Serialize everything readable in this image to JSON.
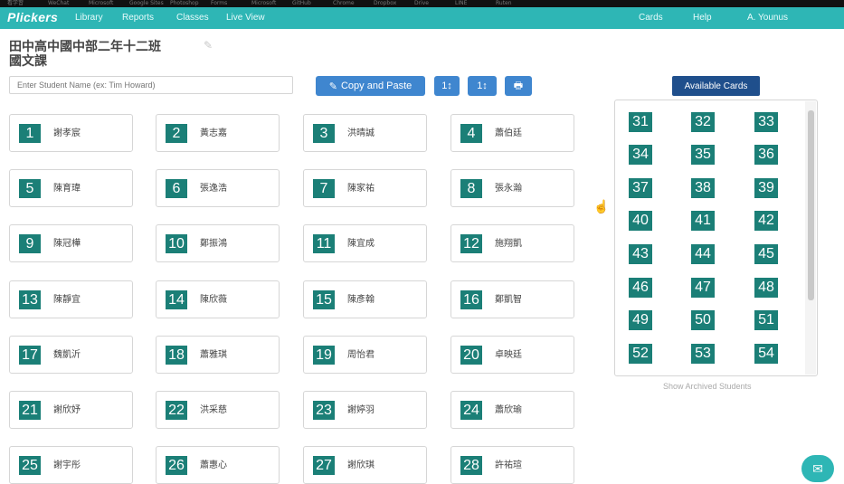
{
  "bookmarks": [
    "看学習",
    "WeChat",
    "Microsoft",
    "Google Sites",
    "Photoshop",
    "Forms",
    "Microsoft",
    "GitHub",
    "Chrome",
    "Dropbox",
    "Drive",
    "LINE",
    "Ruten"
  ],
  "nav": {
    "logo": "Plickers",
    "links": [
      "Library",
      "Reports",
      "Classes",
      "Live View"
    ],
    "right": [
      "Cards",
      "Help",
      "A. Younus"
    ]
  },
  "class": {
    "title_line1": "田中高中國中部二年十二班",
    "title_line2": "國文課"
  },
  "search": {
    "placeholder": "Enter Student Name (ex: Tim Howard)"
  },
  "toolbar": {
    "copy_paste": "Copy and Paste",
    "sort1": "1↕",
    "sort2": "1↕",
    "print": "🖶"
  },
  "students": [
    {
      "num": "1",
      "name": "謝孝宸"
    },
    {
      "num": "2",
      "name": "黃志嘉"
    },
    {
      "num": "3",
      "name": "洪晴誠"
    },
    {
      "num": "4",
      "name": "蕭伯廷"
    },
    {
      "num": "5",
      "name": "陳育瑋"
    },
    {
      "num": "6",
      "name": "張逸浩"
    },
    {
      "num": "7",
      "name": "陳家祐"
    },
    {
      "num": "8",
      "name": "張永瀚"
    },
    {
      "num": "9",
      "name": "陳冠樺"
    },
    {
      "num": "10",
      "name": "鄭振鴻"
    },
    {
      "num": "11",
      "name": "陳宜成"
    },
    {
      "num": "12",
      "name": "施翔凱"
    },
    {
      "num": "13",
      "name": "陳靜宜"
    },
    {
      "num": "14",
      "name": "陳欣薇"
    },
    {
      "num": "15",
      "name": "陳彥翰"
    },
    {
      "num": "16",
      "name": "鄭凱智"
    },
    {
      "num": "17",
      "name": "魏凱沂"
    },
    {
      "num": "18",
      "name": "蕭雅琪"
    },
    {
      "num": "19",
      "name": "周怡君"
    },
    {
      "num": "20",
      "name": "卓映廷"
    },
    {
      "num": "21",
      "name": "謝欣妤"
    },
    {
      "num": "22",
      "name": "洪采慈"
    },
    {
      "num": "23",
      "name": "謝婷羽"
    },
    {
      "num": "24",
      "name": "蕭欣瑜"
    },
    {
      "num": "25",
      "name": "謝宇彤"
    },
    {
      "num": "26",
      "name": "蕭惠心"
    },
    {
      "num": "27",
      "name": "謝欣琪"
    },
    {
      "num": "28",
      "name": "許祐瑄"
    }
  ],
  "available": {
    "button": "Available Cards",
    "cards": [
      "31",
      "32",
      "33",
      "34",
      "35",
      "36",
      "37",
      "38",
      "39",
      "40",
      "41",
      "42",
      "43",
      "44",
      "45",
      "46",
      "47",
      "48",
      "49",
      "50",
      "51",
      "52",
      "53",
      "54"
    ],
    "show_archived": "Show Archived Students"
  },
  "colors": {
    "nav": "#2eb6b5",
    "card_number": "#1b7f77",
    "button": "#3f86cf",
    "available_button": "#1f4f8c"
  },
  "icons": {
    "print": "print-icon",
    "pencil": "pencil-icon",
    "chat": "chat-icon",
    "cursor": "hand-cursor-icon"
  }
}
